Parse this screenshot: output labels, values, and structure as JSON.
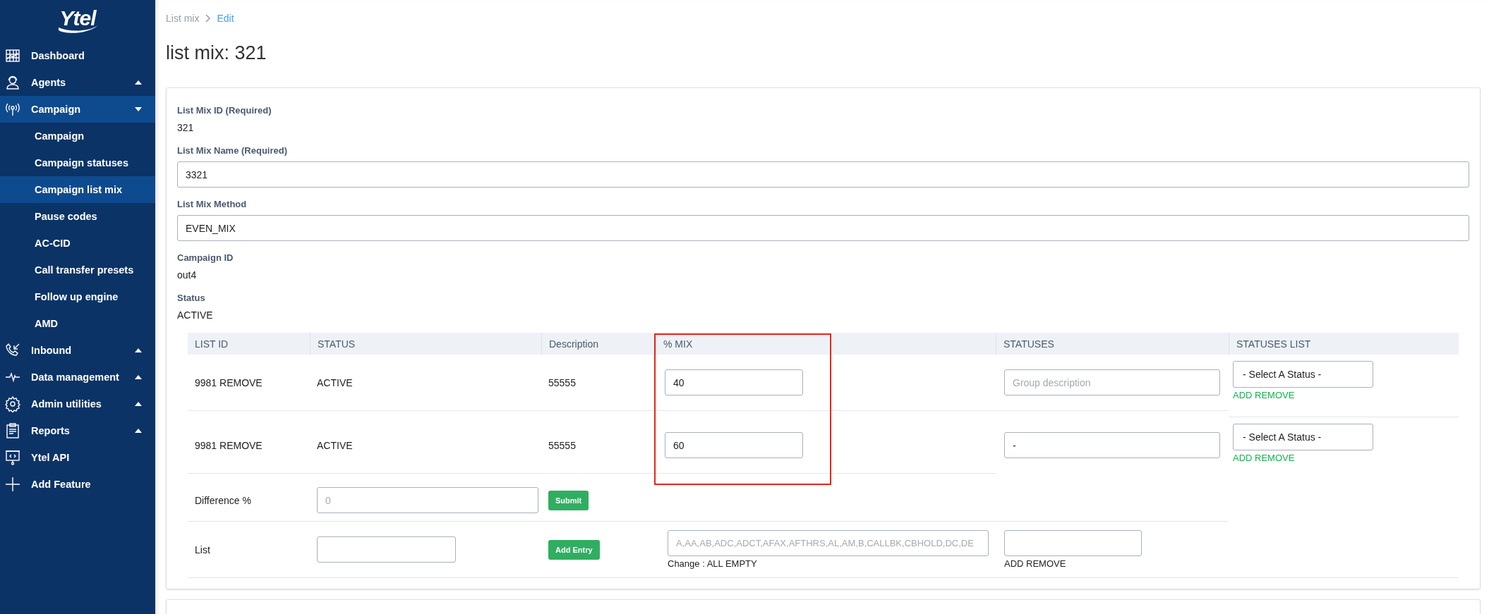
{
  "sidebar": {
    "logo": "Ytel",
    "items": [
      {
        "label": "Dashboard",
        "kind": "link",
        "selected": false
      },
      {
        "label": "Agents",
        "kind": "group",
        "expanded": false,
        "selected": false
      },
      {
        "label": "Campaign",
        "kind": "group",
        "expanded": true,
        "selected": true,
        "children": [
          {
            "label": "Campaign",
            "selected": false
          },
          {
            "label": "Campaign statuses",
            "selected": false
          },
          {
            "label": "Campaign list mix",
            "selected": true
          },
          {
            "label": "Pause codes",
            "selected": false
          },
          {
            "label": "AC-CID",
            "selected": false
          },
          {
            "label": "Call transfer presets",
            "selected": false
          },
          {
            "label": "Follow up engine",
            "selected": false
          },
          {
            "label": "AMD",
            "selected": false
          }
        ]
      },
      {
        "label": "Inbound",
        "kind": "group",
        "expanded": false,
        "selected": false
      },
      {
        "label": "Data management",
        "kind": "group",
        "expanded": false,
        "selected": false
      },
      {
        "label": "Admin utilities",
        "kind": "group",
        "expanded": false,
        "selected": false
      },
      {
        "label": "Reports",
        "kind": "group",
        "expanded": false,
        "selected": false
      },
      {
        "label": "Ytel API",
        "kind": "link",
        "selected": false
      },
      {
        "label": "Add Feature",
        "kind": "link",
        "selected": false
      }
    ]
  },
  "breadcrumb": [
    "List mix",
    "Edit"
  ],
  "title": "list mix: 321",
  "form": [
    {
      "kind": "text",
      "label": "List Mix ID (Required)",
      "value": "321"
    },
    {
      "kind": "input",
      "label": "List Mix Name (Required)",
      "value": "3321"
    },
    {
      "kind": "input",
      "label": "List Mix Method",
      "value": "EVEN_MIX"
    },
    {
      "kind": "text",
      "label": "Campaign ID",
      "value": "out4"
    },
    {
      "kind": "text",
      "label": "Status",
      "value": "ACTIVE"
    }
  ],
  "table": {
    "columns": [
      "LIST ID",
      "STATUS",
      "Description",
      "% MIX",
      "STATUSES",
      "STATUSES LIST"
    ],
    "rows": [
      {
        "list_id": "9981 REMOVE",
        "status": "ACTIVE",
        "description": "55555",
        "mix": "40",
        "statuses": {
          "placeholder": "Group description"
        },
        "status_select": "- Select A Status -",
        "action": "ADD REMOVE"
      },
      {
        "list_id": "9981 REMOVE",
        "status": "ACTIVE",
        "description": "55555",
        "mix": "60",
        "statuses": {
          "value": "-"
        },
        "status_select": "- Select A Status -",
        "action": "ADD REMOVE"
      }
    ],
    "difference": {
      "label": "Difference %",
      "placeholder": "0",
      "button": "Submit"
    },
    "list_entry": {
      "label": "List",
      "button": "Add Entry",
      "codes_placeholder": "A,AA,AB,ADC,ADCT,AFAX,AFTHRS,AL,AM,B,CALLBK,CBHOLD,DC,DE",
      "change_note": "Change : ALL EMPTY",
      "action": "ADD REMOVE"
    }
  }
}
